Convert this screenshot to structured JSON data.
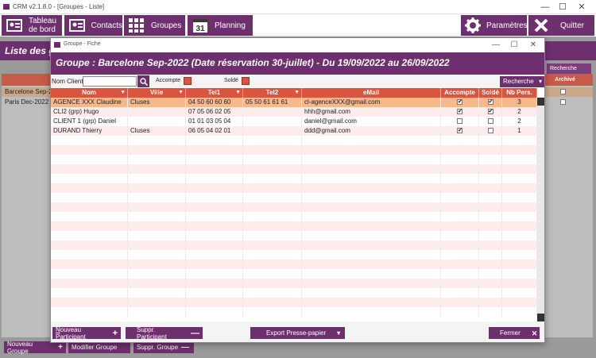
{
  "window": {
    "title": "CRM v2.1.8.0 - [Groupes - Liste]",
    "controls": {
      "minimize": "—",
      "maximize": "☐",
      "close": "✕"
    }
  },
  "toolbar": {
    "dashboard_label_1": "Tableau",
    "dashboard_label_2": "de bord",
    "contacts_label": "Contacts",
    "groupes_label": "Groupes",
    "planning_label": "Planning",
    "planning_icon_text": "31",
    "parametres_label": "Paramètres",
    "quitter_label": "Quitter"
  },
  "background": {
    "header_title": "Liste des g",
    "recherche_label": "Recherche",
    "archive_header": "Archivé",
    "rows": [
      "Barcelone Sep-20",
      "Paris Dec-2022 ("
    ],
    "buttons": {
      "nouveau": "Nouveau Groupe",
      "modifier": "Modifier Groupe",
      "supprimer": "Suppr. Groupe"
    }
  },
  "modal": {
    "window_title": "Groupe - Fiche",
    "header_title": "Groupe : Barcelone Sep-2022 (Date réservation 30-juillet) - Du 19/09/2022 au 26/09/2022",
    "filters": {
      "nom_client_label": "Nom Client",
      "nom_client_value": "",
      "accompte_label": "Accompte",
      "solde_label": "Soldé",
      "recherche_label": "Recherche"
    },
    "columns": [
      "Nom",
      "Ville",
      "Tel1",
      "Tel2",
      "eMail",
      "Accompte",
      "Soldé",
      "Nb Pers."
    ],
    "rows": [
      {
        "nom": "AGENCE XXX Claudine",
        "ville": "Cluses",
        "tel1": "04 50 60 60 60",
        "tel2": "05 50 61 61 61",
        "email": "cl-agenceXXX@gmail.com",
        "accompte": true,
        "solde": true,
        "nb": "3"
      },
      {
        "nom": "CLI2 (grp) Hugo",
        "ville": "",
        "tel1": "07 05 06 02 05",
        "tel2": "",
        "email": "hhh@gmail.com",
        "accompte": true,
        "solde": true,
        "nb": "2"
      },
      {
        "nom": "CLIENT 1 (grp) Daniel",
        "ville": "",
        "tel1": "01 01 03 05 04",
        "tel2": "",
        "email": "daniel@gmail.com",
        "accompte": false,
        "solde": false,
        "nb": "2"
      },
      {
        "nom": "DURAND Thierry",
        "ville": "Cluses",
        "tel1": "06 05 04 02 01",
        "tel2": "",
        "email": "ddd@gmail.com",
        "accompte": true,
        "solde": false,
        "nb": "1"
      }
    ],
    "buttons": {
      "nouveau_participant_underline": "N",
      "nouveau_participant_rest": "ouveau Participant",
      "suppr_participant": "Suppr. Participant",
      "export": "Export Presse-papier",
      "fermer": "Fermer"
    }
  },
  "colors": {
    "brand": "#6e2f6e",
    "header_red": "#d9553f",
    "selected_row": "#f6b98a",
    "alt_row": "#fcecec"
  },
  "icons": [
    "app-icon",
    "dashboard-icon",
    "contacts-icon",
    "grid-icon",
    "calendar-icon",
    "gear-icon",
    "close-x-icon",
    "search-icon",
    "filter-icon",
    "plus-icon",
    "minus-icon",
    "dropdown-caret-icon"
  ]
}
